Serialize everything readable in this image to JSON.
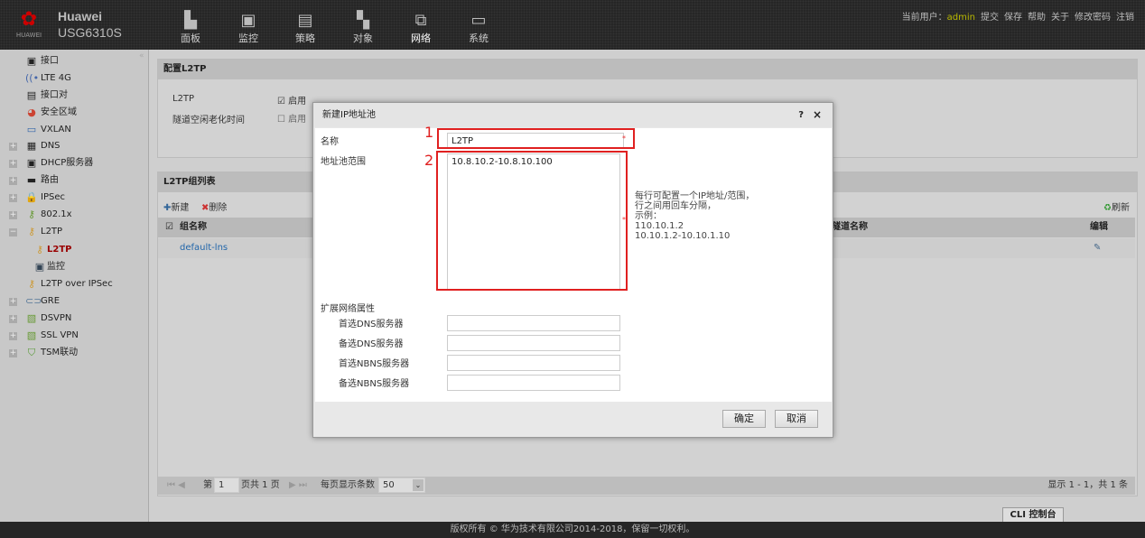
{
  "header": {
    "brand_top": "Huawei",
    "model": "USG6310S",
    "logo_text": "HUAWEI",
    "nav": [
      {
        "label": "面板",
        "icon": "dashboard-icon"
      },
      {
        "label": "监控",
        "icon": "monitor-icon"
      },
      {
        "label": "策略",
        "icon": "policy-icon"
      },
      {
        "label": "对象",
        "icon": "object-icon"
      },
      {
        "label": "网络",
        "icon": "network-icon"
      },
      {
        "label": "系统",
        "icon": "system-icon"
      }
    ],
    "user_label": "当前用户：",
    "user": "admin",
    "links": [
      "提交",
      "保存",
      "帮助",
      "关于",
      "修改密码",
      "注销"
    ]
  },
  "sidebar": {
    "items": [
      {
        "label": "接口"
      },
      {
        "label": "LTE 4G"
      },
      {
        "label": "接口对"
      },
      {
        "label": "安全区域"
      },
      {
        "label": "VXLAN"
      },
      {
        "label": "DNS"
      },
      {
        "label": "DHCP服务器"
      },
      {
        "label": "路由"
      },
      {
        "label": "IPSec"
      },
      {
        "label": "802.1x"
      },
      {
        "label": "L2TP"
      },
      {
        "label": "L2TP"
      },
      {
        "label": "监控"
      },
      {
        "label": "L2TP over IPSec"
      },
      {
        "label": "GRE"
      },
      {
        "label": "DSVPN"
      },
      {
        "label": "SSL VPN"
      },
      {
        "label": "TSM联动"
      }
    ]
  },
  "config": {
    "title": "配置L2TP",
    "l2tp_label": "L2TP",
    "enable": "启用",
    "idle_label": "隧道空闲老化时间",
    "idle_enable": "启用"
  },
  "list": {
    "title": "L2TP组列表",
    "new": "新建",
    "delete": "删除",
    "refresh": "刷新",
    "columns": [
      "组名称",
      "隧道名称",
      "编辑"
    ],
    "rows": [
      {
        "name": "default-lns"
      }
    ],
    "pager": {
      "page_prefix": "第",
      "page": "1",
      "page_suffix": "页共 1 页",
      "per_page_label": "每页显示条数",
      "per_page": "50",
      "summary": "显示 1 - 1，共 1 条"
    }
  },
  "cli": "CLI 控制台",
  "footer": "版权所有 © 华为技术有限公司2014-2018，保留一切权利。",
  "modal": {
    "title": "新建IP地址池",
    "help": "?",
    "close": "×",
    "name_label": "名称",
    "name_value": "L2TP",
    "range_label": "地址池范围",
    "range_value": "10.8.10.2-10.8.10.100",
    "hint": [
      "每行可配置一个IP地址/范围，",
      "行之间用回车分隔，",
      "示例：",
      "110.10.1.2",
      "10.10.1.2-10.10.1.10"
    ],
    "ext_label": "扩展网络属性",
    "fields": [
      "首选DNS服务器",
      "备选DNS服务器",
      "首选NBNS服务器",
      "备选NBNS服务器"
    ],
    "annot": [
      "1",
      "2"
    ],
    "ok": "确定",
    "cancel": "取消"
  }
}
